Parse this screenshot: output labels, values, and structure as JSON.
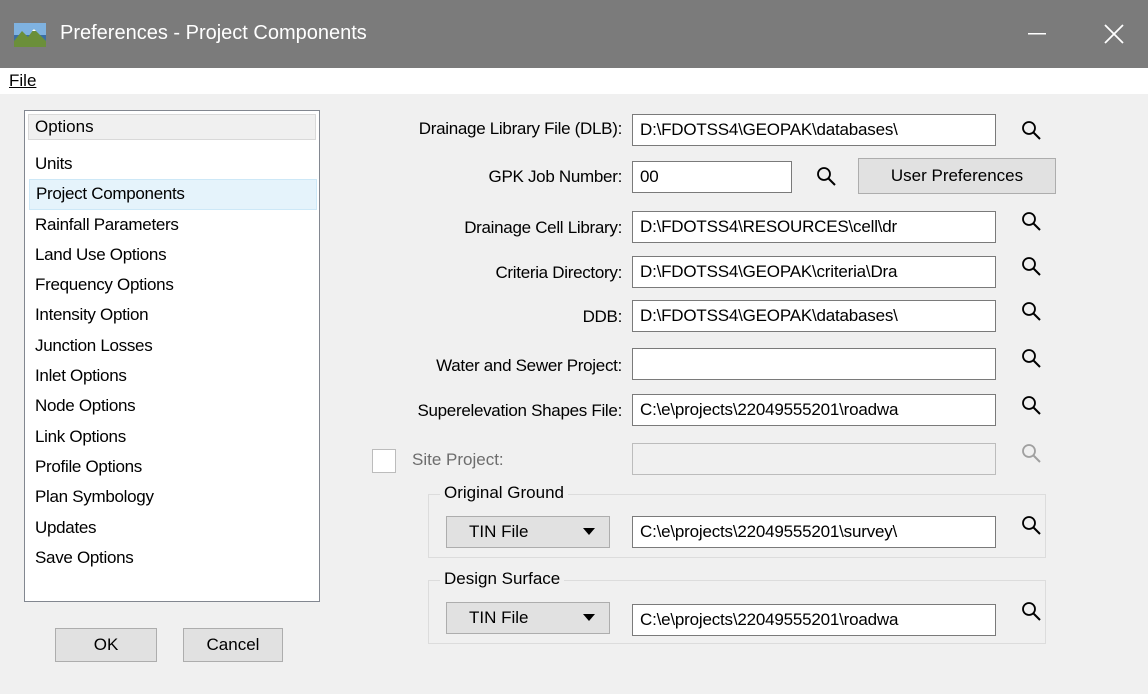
{
  "window": {
    "title": "Preferences - Project Components",
    "minimize_glyph": "—",
    "close_glyph": "✕"
  },
  "menu": {
    "file_label": "File"
  },
  "options_list": {
    "header": "Options",
    "items": [
      "Units",
      "Project Components",
      "Rainfall Parameters",
      "Land Use Options",
      "Frequency Options",
      "Intensity Option",
      "Junction Losses",
      "Inlet Options",
      "Node Options",
      "Link Options",
      "Profile Options",
      "Plan Symbology",
      "Updates",
      "Save Options"
    ],
    "selected_index": 1
  },
  "buttons": {
    "ok": "OK",
    "cancel": "Cancel",
    "user_preferences": "User Preferences"
  },
  "form": {
    "dlb_label": "Drainage Library File (DLB):",
    "dlb_value": "D:\\FDOTSS4\\GEOPAK\\databases\\",
    "gpk_label": "GPK Job Number:",
    "gpk_value": "00",
    "cell_label": "Drainage Cell Library:",
    "cell_value": "D:\\FDOTSS4\\RESOURCES\\cell\\dr",
    "criteria_label": "Criteria Directory:",
    "criteria_value": "D:\\FDOTSS4\\GEOPAK\\criteria\\Dra",
    "ddb_label": "DDB:",
    "ddb_value": "D:\\FDOTSS4\\GEOPAK\\databases\\",
    "water_label": "Water and Sewer Project:",
    "water_value": "",
    "super_label": "Superelevation Shapes File:",
    "super_value": "C:\\e\\projects\\22049555201\\roadwa",
    "site_label": "Site Project:",
    "site_checked": false,
    "site_value": ""
  },
  "original_ground": {
    "title": "Original Ground",
    "type": "TIN File",
    "path": "C:\\e\\projects\\22049555201\\survey\\"
  },
  "design_surface": {
    "title": "Design Surface",
    "type": "TIN File",
    "path": "C:\\e\\projects\\22049555201\\roadwa"
  },
  "icons": {
    "browse": "magnifier-icon",
    "app": "app-landscape-icon",
    "dropdown": "dropdown-arrow-icon"
  }
}
